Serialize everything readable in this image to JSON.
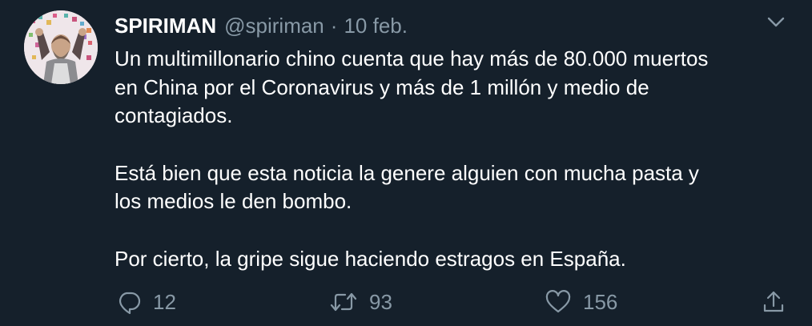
{
  "tweet": {
    "display_name": "SPIRIMAN",
    "handle": "@spiriman",
    "separator": "·",
    "date": "10 feb.",
    "paragraphs": [
      "Un multimillonario chino cuenta que hay más de 80.000 muertos\nen China por el Coronavirus y más de 1 millón y medio de\ncontagiados.",
      "Está bien que esta noticia la genere alguien con mucha pasta y\nlos medios le den bombo.",
      "Por cierto, la gripe sigue haciendo estragos en España."
    ],
    "actions": {
      "reply_count": "12",
      "retweet_count": "93",
      "like_count": "156"
    }
  },
  "icons": {
    "avatar": "avatar-photo",
    "menu": "chevron-down-icon",
    "reply": "reply-icon",
    "retweet": "retweet-icon",
    "like": "heart-icon",
    "share": "share-icon"
  },
  "colors": {
    "background": "#15202b",
    "primary_text": "#ffffff",
    "secondary_text": "#8899a6"
  }
}
